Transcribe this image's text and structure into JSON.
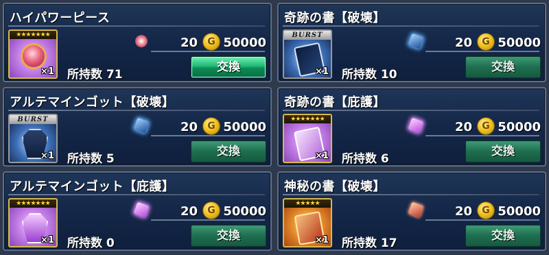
{
  "items": [
    {
      "title": "ハイパワーピース",
      "thumb": "violet",
      "top_badge": "★★★★★★★",
      "art": "art-orb",
      "icon": "gem-orb",
      "quantity": "×1",
      "count": "20",
      "coin_symbol": "G",
      "price": "50000",
      "owned": "所持数 71",
      "button": "交換",
      "button_state": "active"
    },
    {
      "title": "奇跡の書【破壊】",
      "thumb": "burst",
      "top_badge": "BURST",
      "art": "art-book-dark",
      "icon": "gem-blue",
      "quantity": "×1",
      "count": "20",
      "coin_symbol": "G",
      "price": "50000",
      "owned": "所持数 10",
      "button": "交換",
      "button_state": "dim"
    },
    {
      "title": "アルテマインゴット【破壊】",
      "thumb": "burst",
      "top_badge": "BURST",
      "art": "art-coffin-dark",
      "icon": "gem-blue",
      "quantity": "×1",
      "count": "20",
      "coin_symbol": "G",
      "price": "50000",
      "owned": "所持数 5",
      "button": "交換",
      "button_state": "dim"
    },
    {
      "title": "奇跡の書【庇護】",
      "thumb": "violet",
      "top_badge": "★★★★★★★",
      "art": "art-book-violet",
      "icon": "gem-violet",
      "quantity": "×1",
      "count": "20",
      "coin_symbol": "G",
      "price": "50000",
      "owned": "所持数 6",
      "button": "交換",
      "button_state": "dim"
    },
    {
      "title": "アルテマインゴット【庇護】",
      "thumb": "violet",
      "top_badge": "★★★★★★★",
      "art": "art-coffin-violet",
      "icon": "gem-violet",
      "quantity": "×1",
      "count": "20",
      "coin_symbol": "G",
      "price": "50000",
      "owned": "所持数 0",
      "button": "交換",
      "button_state": "dim"
    },
    {
      "title": "神秘の書【破壊】",
      "thumb": "gold",
      "top_badge": "★★★★★",
      "art": "art-book-red",
      "icon": "gem-red",
      "quantity": "×1",
      "count": "20",
      "coin_symbol": "G",
      "price": "50000",
      "owned": "所持数 17",
      "button": "交換",
      "button_state": "dim"
    }
  ]
}
